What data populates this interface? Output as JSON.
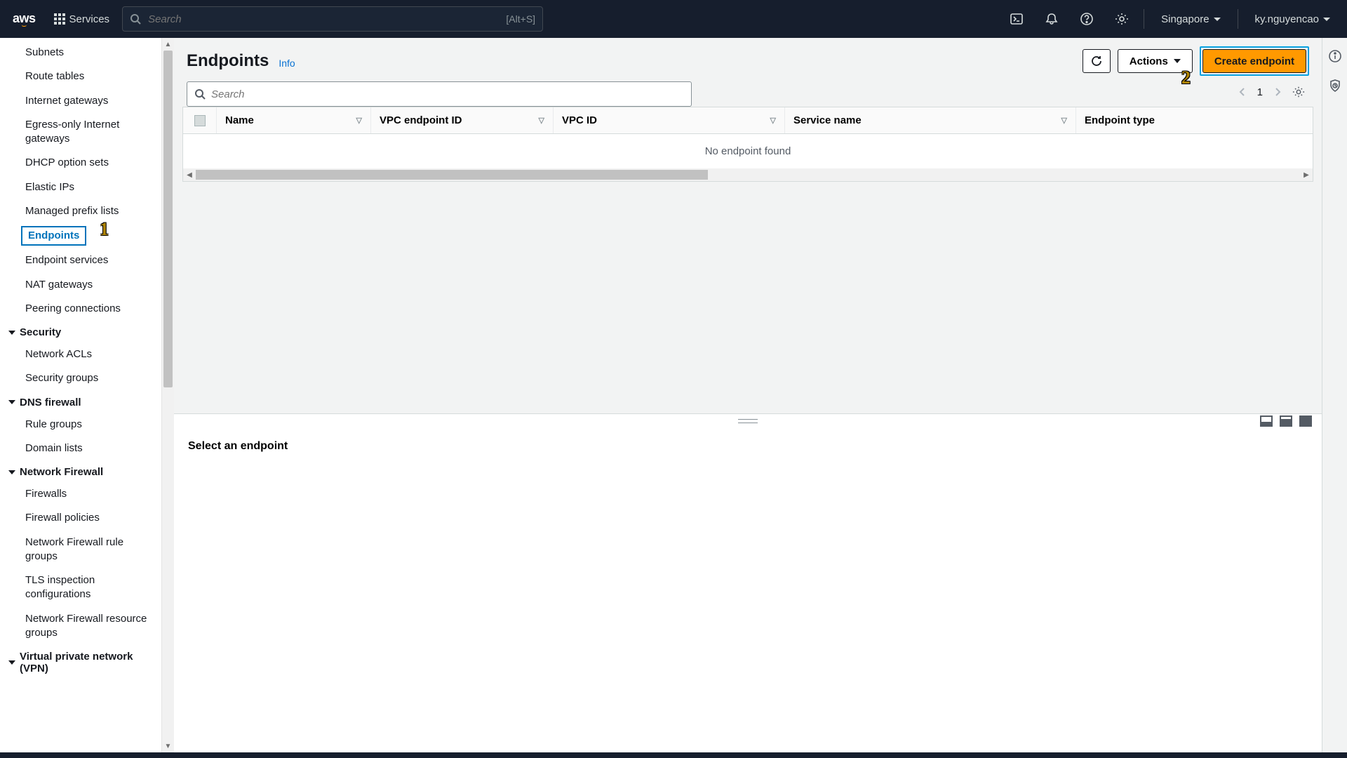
{
  "topnav": {
    "services_label": "Services",
    "search_placeholder": "Search",
    "search_kbd": "[Alt+S]",
    "region": "Singapore",
    "user": "ky.nguyencao"
  },
  "sidebar": {
    "items_top": [
      "Subnets",
      "Route tables",
      "Internet gateways",
      "Egress-only Internet gateways",
      "DHCP option sets",
      "Elastic IPs",
      "Managed prefix lists"
    ],
    "active": "Endpoints",
    "items_mid": [
      "Endpoint services",
      "NAT gateways",
      "Peering connections"
    ],
    "group_security": "Security",
    "security_items": [
      "Network ACLs",
      "Security groups"
    ],
    "group_dns": "DNS firewall",
    "dns_items": [
      "Rule groups",
      "Domain lists"
    ],
    "group_netfw": "Network Firewall",
    "netfw_items": [
      "Firewalls",
      "Firewall policies",
      "Network Firewall rule groups",
      "TLS inspection configurations",
      "Network Firewall resource groups"
    ],
    "group_vpn": "Virtual private network (VPN)"
  },
  "page": {
    "title": "Endpoints",
    "info": "Info",
    "actions": "Actions",
    "create": "Create endpoint",
    "filter_placeholder": "Search",
    "page_num": "1"
  },
  "table": {
    "cols": {
      "name": "Name",
      "vpce": "VPC endpoint ID",
      "vpcid": "VPC ID",
      "svc": "Service name",
      "eptype": "Endpoint type"
    },
    "empty": "No endpoint found"
  },
  "detail": {
    "title": "Select an endpoint"
  },
  "annot": {
    "one": "1",
    "two": "2"
  }
}
